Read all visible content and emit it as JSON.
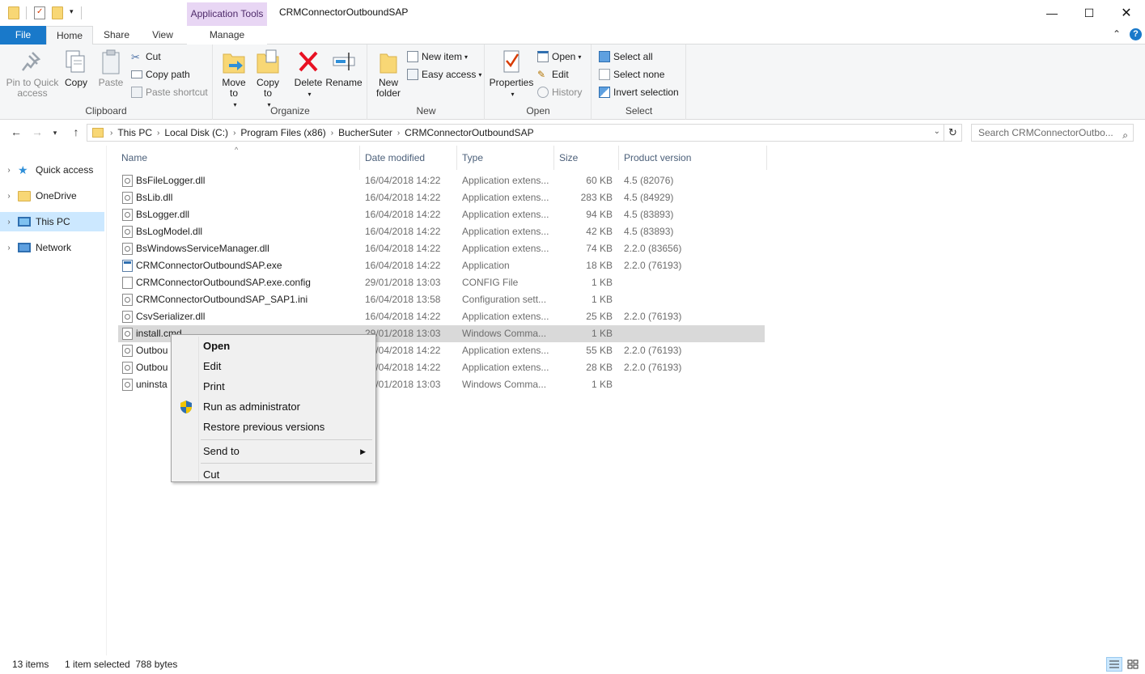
{
  "window": {
    "title": "CRMConnectorOutboundSAP",
    "context_tab": "Application Tools"
  },
  "ribbon_tabs": {
    "file": "File",
    "home": "Home",
    "share": "Share",
    "view": "View",
    "manage": "Manage"
  },
  "ribbon": {
    "clipboard": {
      "label": "Clipboard",
      "pin": "Pin to Quick access",
      "copy": "Copy",
      "paste": "Paste",
      "cut": "Cut",
      "copy_path": "Copy path",
      "paste_shortcut": "Paste shortcut"
    },
    "organize": {
      "label": "Organize",
      "move_to": "Move to",
      "copy_to": "Copy to",
      "delete": "Delete",
      "rename": "Rename"
    },
    "new": {
      "label": "New",
      "new_folder": "New folder",
      "new_item": "New item",
      "easy_access": "Easy access"
    },
    "open": {
      "label": "Open",
      "properties": "Properties",
      "open": "Open",
      "edit": "Edit",
      "history": "History"
    },
    "select": {
      "label": "Select",
      "select_all": "Select all",
      "select_none": "Select none",
      "invert_selection": "Invert selection"
    }
  },
  "address": {
    "crumbs": [
      "This PC",
      "Local Disk (C:)",
      "Program Files (x86)",
      "BucherSuter",
      "CRMConnectorOutboundSAP"
    ],
    "search_placeholder": "Search CRMConnectorOutbo..."
  },
  "nav_pane": {
    "items": [
      {
        "label": "Quick access"
      },
      {
        "label": "OneDrive"
      },
      {
        "label": "This PC"
      },
      {
        "label": "Network"
      }
    ]
  },
  "columns": {
    "name": "Name",
    "date": "Date modified",
    "type": "Type",
    "size": "Size",
    "version": "Product version"
  },
  "files": [
    {
      "name": "BsFileLogger.dll",
      "date": "16/04/2018 14:22",
      "type": "Application extens...",
      "size": "60 KB",
      "version": "4.5 (82076)"
    },
    {
      "name": "BsLib.dll",
      "date": "16/04/2018 14:22",
      "type": "Application extens...",
      "size": "283 KB",
      "version": "4.5 (84929)"
    },
    {
      "name": "BsLogger.dll",
      "date": "16/04/2018 14:22",
      "type": "Application extens...",
      "size": "94 KB",
      "version": "4.5 (83893)"
    },
    {
      "name": "BsLogModel.dll",
      "date": "16/04/2018 14:22",
      "type": "Application extens...",
      "size": "42 KB",
      "version": "4.5 (83893)"
    },
    {
      "name": "BsWindowsServiceManager.dll",
      "date": "16/04/2018 14:22",
      "type": "Application extens...",
      "size": "74 KB",
      "version": "2.2.0 (83656)"
    },
    {
      "name": "CRMConnectorOutboundSAP.exe",
      "date": "16/04/2018 14:22",
      "type": "Application",
      "size": "18 KB",
      "version": "2.2.0 (76193)"
    },
    {
      "name": "CRMConnectorOutboundSAP.exe.config",
      "date": "29/01/2018 13:03",
      "type": "CONFIG File",
      "size": "1 KB",
      "version": ""
    },
    {
      "name": "CRMConnectorOutboundSAP_SAP1.ini",
      "date": "16/04/2018 13:58",
      "type": "Configuration sett...",
      "size": "1 KB",
      "version": ""
    },
    {
      "name": "CsvSerializer.dll",
      "date": "16/04/2018 14:22",
      "type": "Application extens...",
      "size": "25 KB",
      "version": "2.2.0 (76193)"
    },
    {
      "name": "install.cmd",
      "date": "29/01/2018 13:03",
      "type": "Windows Comma...",
      "size": "1 KB",
      "version": ""
    },
    {
      "name": "Outbou",
      "date": "16/04/2018 14:22",
      "type": "Application extens...",
      "size": "55 KB",
      "version": "2.2.0 (76193)"
    },
    {
      "name": "Outbou",
      "date": "16/04/2018 14:22",
      "type": "Application extens...",
      "size": "28 KB",
      "version": "2.2.0 (76193)"
    },
    {
      "name": "uninsta",
      "date": "29/01/2018 13:03",
      "type": "Windows Comma...",
      "size": "1 KB",
      "version": ""
    }
  ],
  "context_menu": {
    "open": "Open",
    "edit": "Edit",
    "print": "Print",
    "run_as_admin": "Run as administrator",
    "restore": "Restore previous versions",
    "send_to": "Send to",
    "cut": "Cut"
  },
  "status": {
    "item_count": "13 items",
    "selection": "1 item selected  788 bytes"
  },
  "colors": {
    "accent": "#1979ca",
    "context_tab": "#e8d6f4",
    "selection": "#cce8ff",
    "row_selected": "#d9d9d9"
  }
}
